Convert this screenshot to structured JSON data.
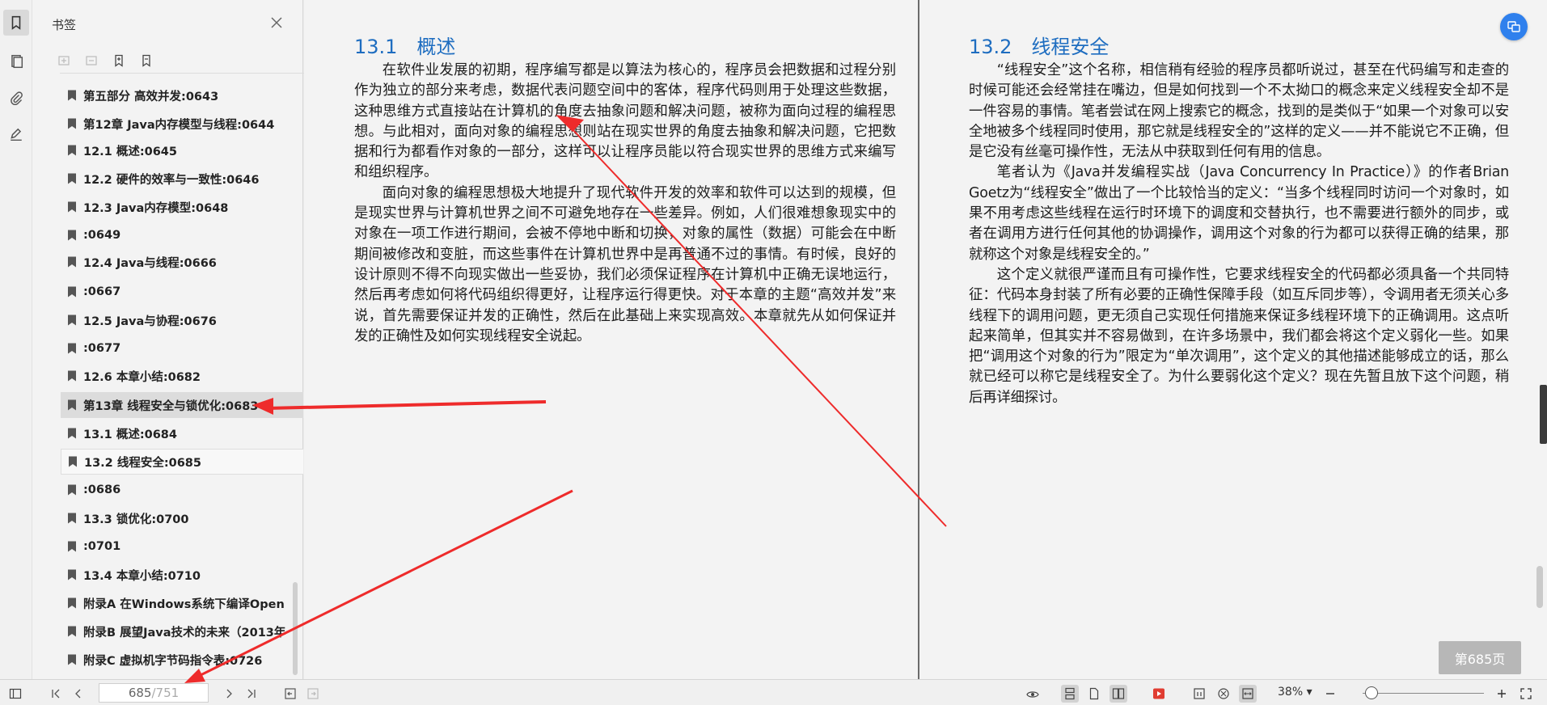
{
  "colors": {
    "accent": "#1e6dc0",
    "arrow": "#ee2b2b",
    "float_button": "#2f80ed"
  },
  "panel": {
    "title": "书签",
    "close_icon": "close-icon",
    "tools": [
      "add-bookmark-icon",
      "remove-bookmark-icon",
      "bookmark-expand-icon",
      "bookmark-icon"
    ],
    "items": [
      {
        "label": "第五部分 高效并发:0643"
      },
      {
        "label": "第12章 Java内存模型与线程:0644"
      },
      {
        "label": "12.1 概述:0645"
      },
      {
        "label": "12.2 硬件的效率与一致性:0646"
      },
      {
        "label": "12.3 Java内存模型:0648"
      },
      {
        "label": ":0649"
      },
      {
        "label": "12.4 Java与线程:0666"
      },
      {
        "label": ":0667"
      },
      {
        "label": "12.5 Java与协程:0676"
      },
      {
        "label": ":0677"
      },
      {
        "label": "12.6 本章小结:0682"
      },
      {
        "label": "第13章 线程安全与锁优化:0683"
      },
      {
        "label": "13.1 概述:0684"
      },
      {
        "label": "13.2 线程安全:0685"
      },
      {
        "label": ":0686"
      },
      {
        "label": "13.3 锁优化:0700"
      },
      {
        "label": ":0701"
      },
      {
        "label": "13.4 本章小结:0710"
      },
      {
        "label": "附录A 在Windows系统下编译Open"
      },
      {
        "label": "附录B 展望Java技术的未来（2013年"
      },
      {
        "label": "附录C 虚拟机字节码指令表:0726"
      }
    ]
  },
  "doc": {
    "left": {
      "heading": "13.1　概述",
      "paragraphs": [
        "在软件业发展的初期，程序编写都是以算法为核心的，程序员会把数据和过程分别作为独立的部分来考虑，数据代表问题空间中的客体，程序代码则用于处理这些数据，这种思维方式直接站在计算机的角度去抽象问题和解决问题，被称为面向过程的编程思想。与此相对，面向对象的编程思想则站在现实世界的角度去抽象和解决问题，它把数据和行为都看作对象的一部分，这样可以让程序员能以符合现实世界的思维方式来编写和组织程序。",
        "面向对象的编程思想极大地提升了现代软件开发的效率和软件可以达到的规模，但是现实世界与计算机世界之间不可避免地存在一些差异。例如，人们很难想象现实中的对象在一项工作进行期间，会被不停地中断和切换，对象的属性（数据）可能会在中断期间被修改和变脏，而这些事件在计算机世界中是再普通不过的事情。有时候，良好的设计原则不得不向现实做出一些妥协，我们必须保证程序在计算机中正确无误地运行，然后再考虑如何将代码组织得更好，让程序运行得更快。对于本章的主题“高效并发”来说，首先需要保证并发的正确性，然后在此基础上来实现高效。本章就先从如何保证并发的正确性及如何实现线程安全说起。"
      ]
    },
    "right": {
      "heading": "13.2　线程安全",
      "paragraphs": [
        "“线程安全”这个名称，相信稍有经验的程序员都听说过，甚至在代码编写和走查的时候可能还会经常挂在嘴边，但是如何找到一个不太拗口的概念来定义线程安全却不是一件容易的事情。笔者尝试在网上搜索它的概念，找到的是类似于“如果一个对象可以安全地被多个线程同时使用，那它就是线程安全的”这样的定义——并不能说它不正确，但是它没有丝毫可操作性，无法从中获取到任何有用的信息。",
        "笔者认为《Java并发编程实战（Java Concurrency In Practice）》的作者Brian Goetz为“线程安全”做出了一个比较恰当的定义：“当多个线程同时访问一个对象时，如果不用考虑这些线程在运行时环境下的调度和交替执行，也不需要进行额外的同步，或者在调用方进行任何其他的协调操作，调用这个对象的行为都可以获得正确的结果，那就称这个对象是线程安全的。”",
        "这个定义就很严谨而且有可操作性，它要求线程安全的代码都必须具备一个共同特征：代码本身封装了所有必要的正确性保障手段（如互斥同步等），令调用者无须关心多线程下的调用问题，更无须自己实现任何措施来保证多线程环境下的正确调用。这点听起来简单，但其实并不容易做到，在许多场景中，我们都会将这个定义弱化一些。如果把“调用这个对象的行为”限定为“单次调用”，这个定义的其他描述能够成立的话，那么就已经可以称它是线程安全了。为什么要弱化这个定义？现在先暂且放下这个问题，稍后再详细探讨。"
      ]
    },
    "page_badge": "第685页"
  },
  "status": {
    "page_current": "685",
    "page_total": "/751",
    "zoom": "38%"
  }
}
